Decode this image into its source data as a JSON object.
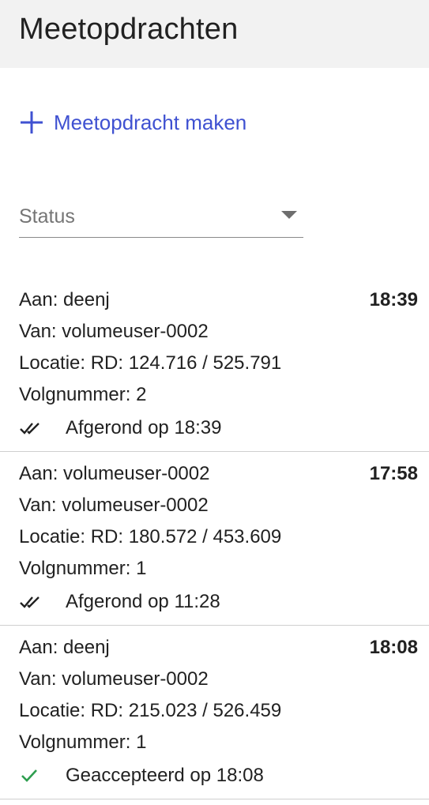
{
  "header": {
    "title": "Meetopdrachten"
  },
  "create_button": {
    "label": "Meetopdracht maken",
    "icon": "plus-icon",
    "color": "#3f51d1"
  },
  "status_filter": {
    "placeholder": "Status",
    "icon": "chevron-down-icon"
  },
  "assignments": [
    {
      "to": "Aan: deenj",
      "from": "Van: volumeuser-0002",
      "location": "Locatie: RD: 124.716 / 525.791",
      "sequence": "Volgnummer: 2",
      "time": "18:39",
      "status_text": "Afgerond op 18:39",
      "status_icon": "double-check-icon",
      "status_color": "#212121"
    },
    {
      "to": "Aan: volumeuser-0002",
      "from": "Van: volumeuser-0002",
      "location": "Locatie: RD: 180.572 / 453.609",
      "sequence": "Volgnummer: 1",
      "time": "17:58",
      "status_text": "Afgerond op 11:28",
      "status_icon": "double-check-icon",
      "status_color": "#212121"
    },
    {
      "to": "Aan: deenj",
      "from": "Van: volumeuser-0002",
      "location": "Locatie: RD: 215.023 / 526.459",
      "sequence": "Volgnummer: 1",
      "time": "18:08",
      "status_text": "Geaccepteerd op 18:08",
      "status_icon": "check-icon",
      "status_color": "#2e9e4f"
    }
  ]
}
